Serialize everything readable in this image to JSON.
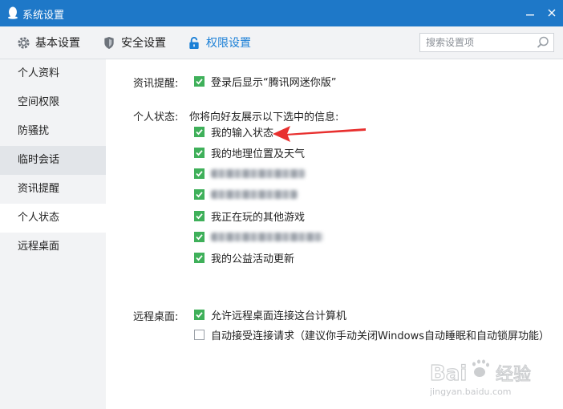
{
  "window": {
    "title": "系统设置",
    "accent": "#1e78c8"
  },
  "tabs": [
    {
      "label": "基本设置",
      "icon": "gear-icon"
    },
    {
      "label": "安全设置",
      "icon": "shield-icon"
    },
    {
      "label": "权限设置",
      "icon": "lock-icon",
      "active": true
    }
  ],
  "search": {
    "placeholder": "搜索设置项",
    "value": ""
  },
  "sidebar": {
    "items": [
      {
        "label": "个人资料"
      },
      {
        "label": "空间权限"
      },
      {
        "label": "防骚扰"
      },
      {
        "label": "临时会话"
      },
      {
        "label": "资讯提醒"
      },
      {
        "label": "个人状态"
      },
      {
        "label": "远程桌面"
      }
    ]
  },
  "news": {
    "label": "资讯提醒:",
    "option": "登录后显示“腾讯网迷你版”",
    "checked": true
  },
  "status": {
    "label": "个人状态:",
    "description": "你将向好友展示以下选中的信息:",
    "options": [
      {
        "text": "我的输入状态",
        "checked": true
      },
      {
        "text": "我的地理位置及天气",
        "checked": true
      },
      {
        "text": "",
        "checked": true,
        "blurred": true
      },
      {
        "text": "",
        "checked": true,
        "blurred": true
      },
      {
        "text": "我正在玩的其他游戏",
        "checked": true
      },
      {
        "text": "",
        "checked": true,
        "blurred": true
      },
      {
        "text": "我的公益活动更新",
        "checked": true
      }
    ]
  },
  "remote": {
    "label": "远程桌面:",
    "options": [
      {
        "text": "允许远程桌面连接这台计算机",
        "checked": true
      },
      {
        "text": "自动接受连接请求（建议你手动关闭Windows自动睡眠和自动锁屏功能）",
        "checked": false
      }
    ]
  },
  "watermark": {
    "line1": "Bai",
    "line2": "经验",
    "line3": "jingyan.baidu.com"
  },
  "colors": {
    "checkbox": "#3fb05a",
    "arrow": "#e8302f",
    "active_tab": "#1a7fd6"
  }
}
